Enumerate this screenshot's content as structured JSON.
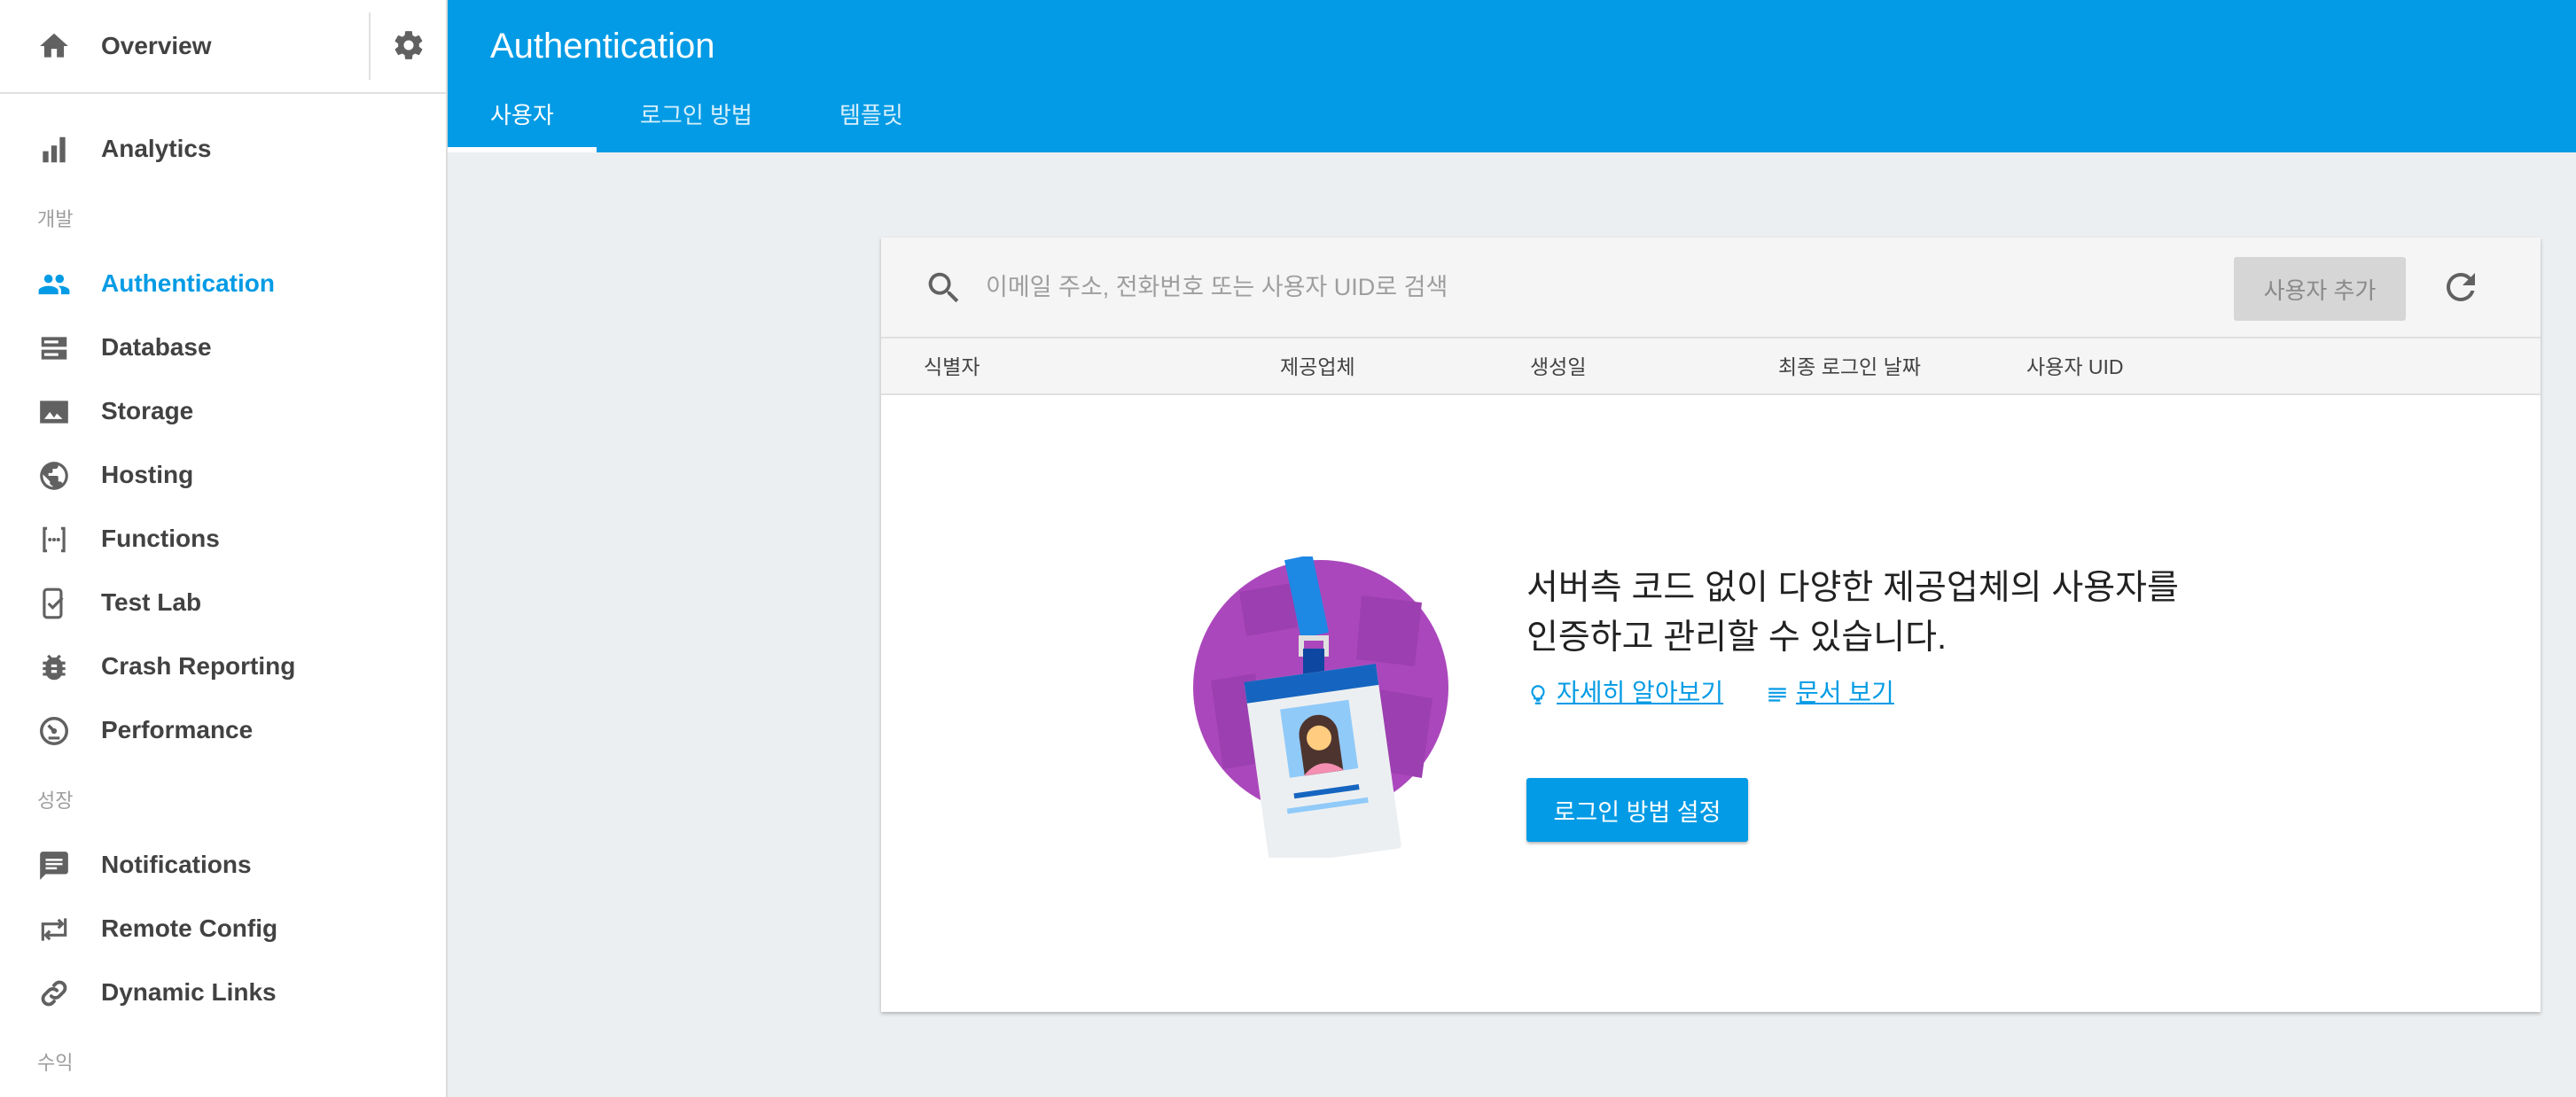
{
  "sidebar": {
    "overview_label": "Overview",
    "items": [
      {
        "label": "Analytics"
      },
      {
        "label": "Authentication"
      },
      {
        "label": "Database"
      },
      {
        "label": "Storage"
      },
      {
        "label": "Hosting"
      },
      {
        "label": "Functions"
      },
      {
        "label": "Test Lab"
      },
      {
        "label": "Crash Reporting"
      },
      {
        "label": "Performance"
      },
      {
        "label": "Notifications"
      },
      {
        "label": "Remote Config"
      },
      {
        "label": "Dynamic Links"
      }
    ],
    "sections": {
      "develop": "개발",
      "grow": "성장",
      "earn": "수익"
    },
    "active_item": "Authentication"
  },
  "header": {
    "title": "Authentication",
    "tabs": [
      {
        "label": "사용자",
        "active": true
      },
      {
        "label": "로그인 방법",
        "active": false
      },
      {
        "label": "템플릿",
        "active": false
      }
    ]
  },
  "users": {
    "search": {
      "placeholder": "이메일 주소, 전화번호 또는 사용자 UID로 검색",
      "value": ""
    },
    "add_user_label": "사용자 추가",
    "columns": [
      "식별자",
      "제공업체",
      "생성일",
      "최종 로그인 날짜",
      "사용자 UID"
    ],
    "empty_state": {
      "message": "서버측 코드 없이 다양한 제공업체의 사용자를 인증하고 관리할 수 있습니다.",
      "learn_more": "자세히 알아보기",
      "view_docs": "문서 보기",
      "setup_button": "로그인 방법 설정"
    }
  },
  "colors": {
    "accent": "#039be5",
    "header_bg": "#039be5",
    "page_bg": "#eceff1",
    "illustration": "#ab47bc"
  }
}
